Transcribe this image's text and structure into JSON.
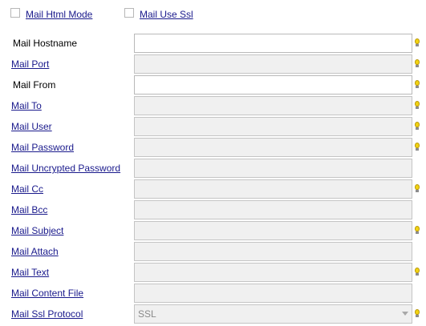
{
  "checkboxes": [
    {
      "label": "Mail Html Mode",
      "checked": false
    },
    {
      "label": "Mail Use Ssl",
      "checked": false
    }
  ],
  "fields": [
    {
      "label": "Mail Hostname",
      "link": false,
      "editable": true,
      "value": "",
      "hint": true
    },
    {
      "label": "Mail Port",
      "link": true,
      "editable": false,
      "value": "",
      "hint": true
    },
    {
      "label": "Mail From",
      "link": false,
      "editable": true,
      "value": "",
      "hint": true
    },
    {
      "label": "Mail To",
      "link": true,
      "editable": false,
      "value": "",
      "hint": true
    },
    {
      "label": "Mail User",
      "link": true,
      "editable": false,
      "value": "",
      "hint": true
    },
    {
      "label": "Mail Password",
      "link": true,
      "editable": false,
      "value": "",
      "hint": true
    },
    {
      "label": "Mail Uncrypted Password",
      "link": true,
      "editable": false,
      "value": "",
      "hint": false
    },
    {
      "label": "Mail Cc",
      "link": true,
      "editable": false,
      "value": "",
      "hint": true
    },
    {
      "label": "Mail Bcc",
      "link": true,
      "editable": false,
      "value": "",
      "hint": false
    },
    {
      "label": "Mail Subject",
      "link": true,
      "editable": false,
      "value": "",
      "hint": true
    },
    {
      "label": "Mail Attach",
      "link": true,
      "editable": false,
      "value": "",
      "hint": false
    },
    {
      "label": "Mail Text",
      "link": true,
      "editable": false,
      "value": "",
      "hint": true
    },
    {
      "label": "Mail Content File",
      "link": true,
      "editable": false,
      "value": "",
      "hint": false
    },
    {
      "label": "Mail Ssl Protocol",
      "link": true,
      "editable": false,
      "value": "SSL",
      "type": "select",
      "hint": true
    }
  ],
  "icons": {
    "hint": "lightbulb-icon",
    "dropdown": "chevron-down-icon"
  },
  "colors": {
    "link": "#1a1a8c",
    "disabled_field": "#f0f0f0",
    "hint_bulb": "#f2d312"
  }
}
